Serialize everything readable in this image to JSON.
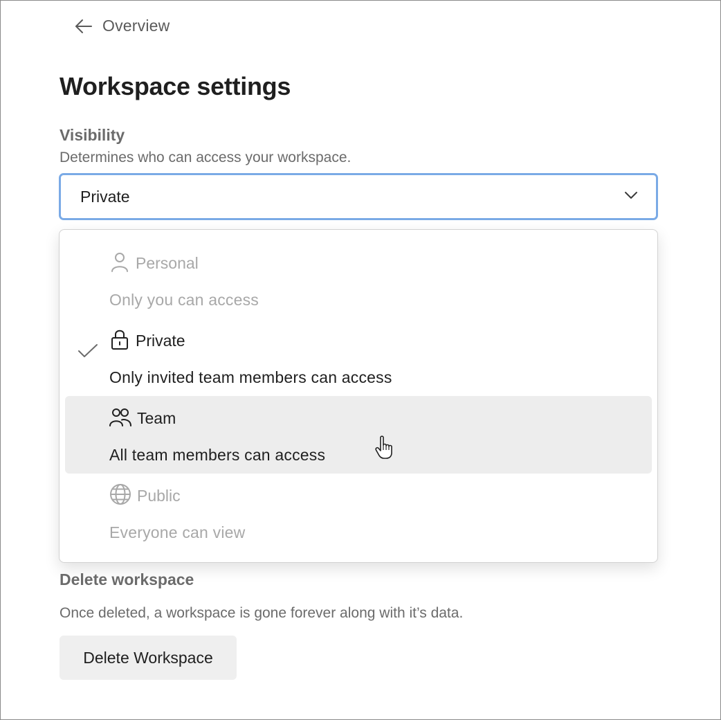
{
  "nav": {
    "back_label": "Overview",
    "back_icon": "arrow-left-icon"
  },
  "page": {
    "title": "Workspace settings"
  },
  "visibility": {
    "heading": "Visibility",
    "description": "Determines who can access your workspace.",
    "selected_value": "Private",
    "focus_color": "#7aaae6",
    "options": [
      {
        "label": "Personal",
        "description": "Only you can access",
        "icon": "user-icon",
        "state": "disabled"
      },
      {
        "label": "Private",
        "description": "Only invited team members can access",
        "icon": "lock-icon",
        "state": "selected"
      },
      {
        "label": "Team",
        "description": "All team members can access",
        "icon": "users-icon",
        "state": "hovered"
      },
      {
        "label": "Public",
        "description": "Everyone can view",
        "icon": "globe-icon",
        "state": "disabled"
      }
    ]
  },
  "danger_zone": {
    "heading": "Delete workspace",
    "description": "Once deleted, a workspace is gone forever along with it’s data.",
    "button_label": "Delete Workspace"
  }
}
